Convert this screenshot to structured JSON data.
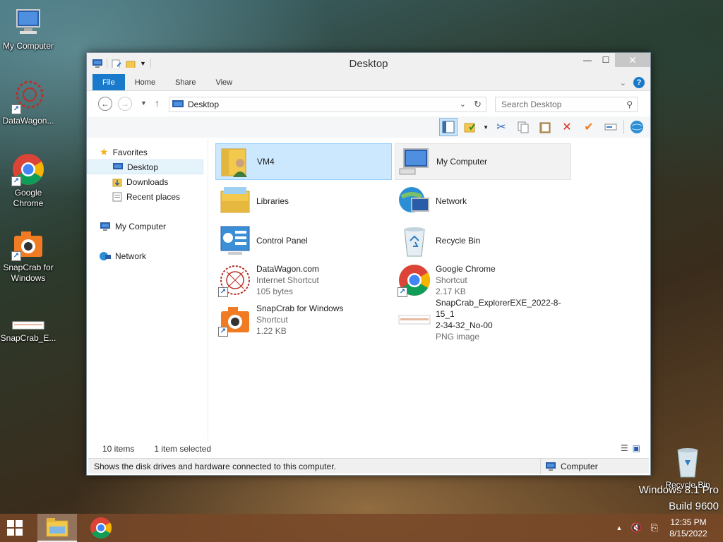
{
  "desktop": {
    "icons": [
      {
        "label": "My Computer",
        "icon": "computer-icon"
      },
      {
        "label": "DataWagon...",
        "icon": "datawagon-icon"
      },
      {
        "label": "Google Chrome",
        "icon": "chrome-icon"
      },
      {
        "label": "SnapCrab for Windows",
        "icon": "snapcrab-icon"
      },
      {
        "label": "SnapCrab_E...",
        "icon": "png-image-icon"
      }
    ],
    "recycle_bin_label": "Recycle Bin",
    "watermark_line1": "Windows 8.1 Pro",
    "watermark_line2": "Build 9600"
  },
  "window": {
    "title": "Desktop",
    "controls": {
      "minimize": "—",
      "maximize": "☐",
      "close": "✕"
    },
    "ribbon": {
      "tabs": [
        "File",
        "Home",
        "Share",
        "View"
      ],
      "help": "?"
    },
    "address": {
      "path": "Desktop",
      "search_placeholder": "Search Desktop"
    },
    "nav": {
      "favorites": "Favorites",
      "favorites_items": [
        "Desktop",
        "Downloads",
        "Recent places"
      ],
      "computer": "My Computer",
      "network": "Network"
    },
    "items": [
      {
        "name": "VM4",
        "lines": [],
        "icon": "user-folder-icon"
      },
      {
        "name": "My Computer",
        "lines": [],
        "icon": "computer-icon"
      },
      {
        "name": "Libraries",
        "lines": [],
        "icon": "libraries-icon"
      },
      {
        "name": "Network",
        "lines": [],
        "icon": "network-icon"
      },
      {
        "name": "Control Panel",
        "lines": [],
        "icon": "control-panel-icon"
      },
      {
        "name": "Recycle Bin",
        "lines": [],
        "icon": "recycle-bin-icon"
      },
      {
        "name": "DataWagon.com",
        "lines": [
          "Internet Shortcut",
          "105 bytes"
        ],
        "icon": "datawagon-icon"
      },
      {
        "name": "Google Chrome",
        "lines": [
          "Shortcut",
          "2.17 KB"
        ],
        "icon": "chrome-icon"
      },
      {
        "name": "SnapCrab for Windows",
        "lines": [
          "Shortcut",
          "1.22 KB"
        ],
        "icon": "snapcrab-icon"
      },
      {
        "name": "SnapCrab_ExplorerEXE_2022-8-15_1",
        "name2": "2-34-32_No-00",
        "lines": [
          "PNG image"
        ],
        "icon": "png-image-icon"
      }
    ],
    "status": {
      "count": "10 items",
      "selected": "1 item selected",
      "description": "Shows the disk drives and hardware connected to this computer.",
      "location": "Computer"
    }
  },
  "taskbar": {
    "time": "12:35 PM",
    "date": "8/15/2022"
  }
}
